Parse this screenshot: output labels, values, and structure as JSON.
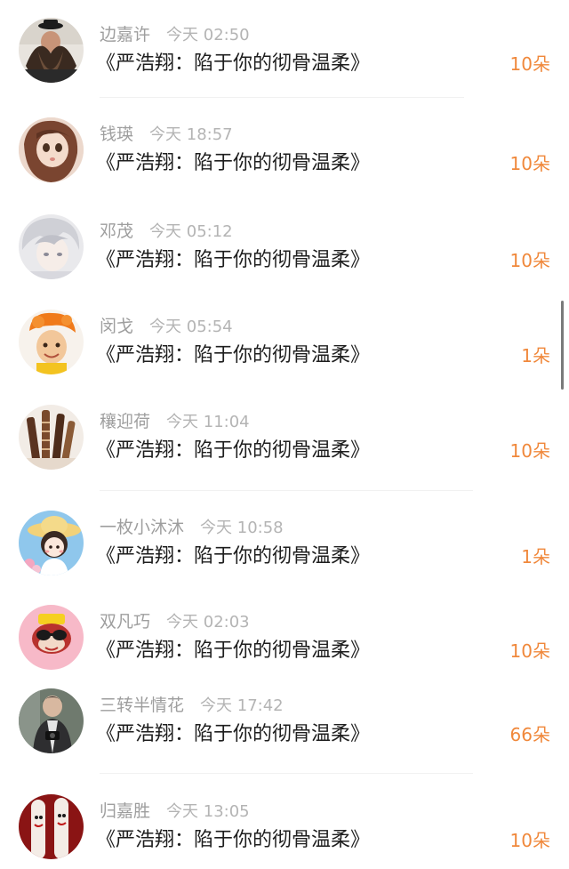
{
  "list": [
    {
      "username": "边嘉许",
      "time": "今天 02:50",
      "book": "《严浩翔：陷于你的彻骨温柔》",
      "gift": "10朵",
      "avatar_icon": "bearded-man-avatar-icon"
    },
    {
      "username": "钱瑛",
      "time": "今天 18:57",
      "book": "《严浩翔：陷于你的彻骨温柔》",
      "gift": "10朵",
      "avatar_icon": "doll-girl-avatar-icon"
    },
    {
      "username": "邓茂",
      "time": "今天 05:12",
      "book": "《严浩翔：陷于你的彻骨温柔》",
      "gift": "10朵",
      "avatar_icon": "anime-boy-avatar-icon"
    },
    {
      "username": "闵戈",
      "time": "今天 05:54",
      "book": "《严浩翔：陷于你的彻骨温柔》",
      "gift": "1朵",
      "avatar_icon": "child-orange-hat-avatar-icon"
    },
    {
      "username": "穰迎荷",
      "time": "今天 11:04",
      "book": "《严浩翔：陷于你的彻骨温柔》",
      "gift": "10朵",
      "avatar_icon": "chocolate-sticks-avatar-icon"
    },
    {
      "username": "一枚小沐沐",
      "time": "今天 10:58",
      "book": "《严浩翔：陷于你的彻骨温柔》",
      "gift": "1朵",
      "avatar_icon": "cartoon-girl-straw-hat-avatar-icon"
    },
    {
      "username": "双凡巧",
      "time": "今天 02:03",
      "book": "《严浩翔：陷于你的彻骨温柔》",
      "gift": "10朵",
      "avatar_icon": "monkey-sunglasses-avatar-icon"
    },
    {
      "username": "三转半情花",
      "time": "今天 17:42",
      "book": "《严浩翔：陷于你的彻骨温柔》",
      "gift": "66朵",
      "avatar_icon": "man-with-camera-avatar-icon"
    },
    {
      "username": "归嘉胜",
      "time": "今天 13:05",
      "book": "《严浩翔：陷于你的彻骨温柔》",
      "gift": "10朵",
      "avatar_icon": "painted-fingers-avatar-icon"
    }
  ],
  "colors": {
    "gift": "#f0883b",
    "username": "#9e9e9e",
    "time": "#b4b4b4",
    "book": "#1e1e1e"
  }
}
